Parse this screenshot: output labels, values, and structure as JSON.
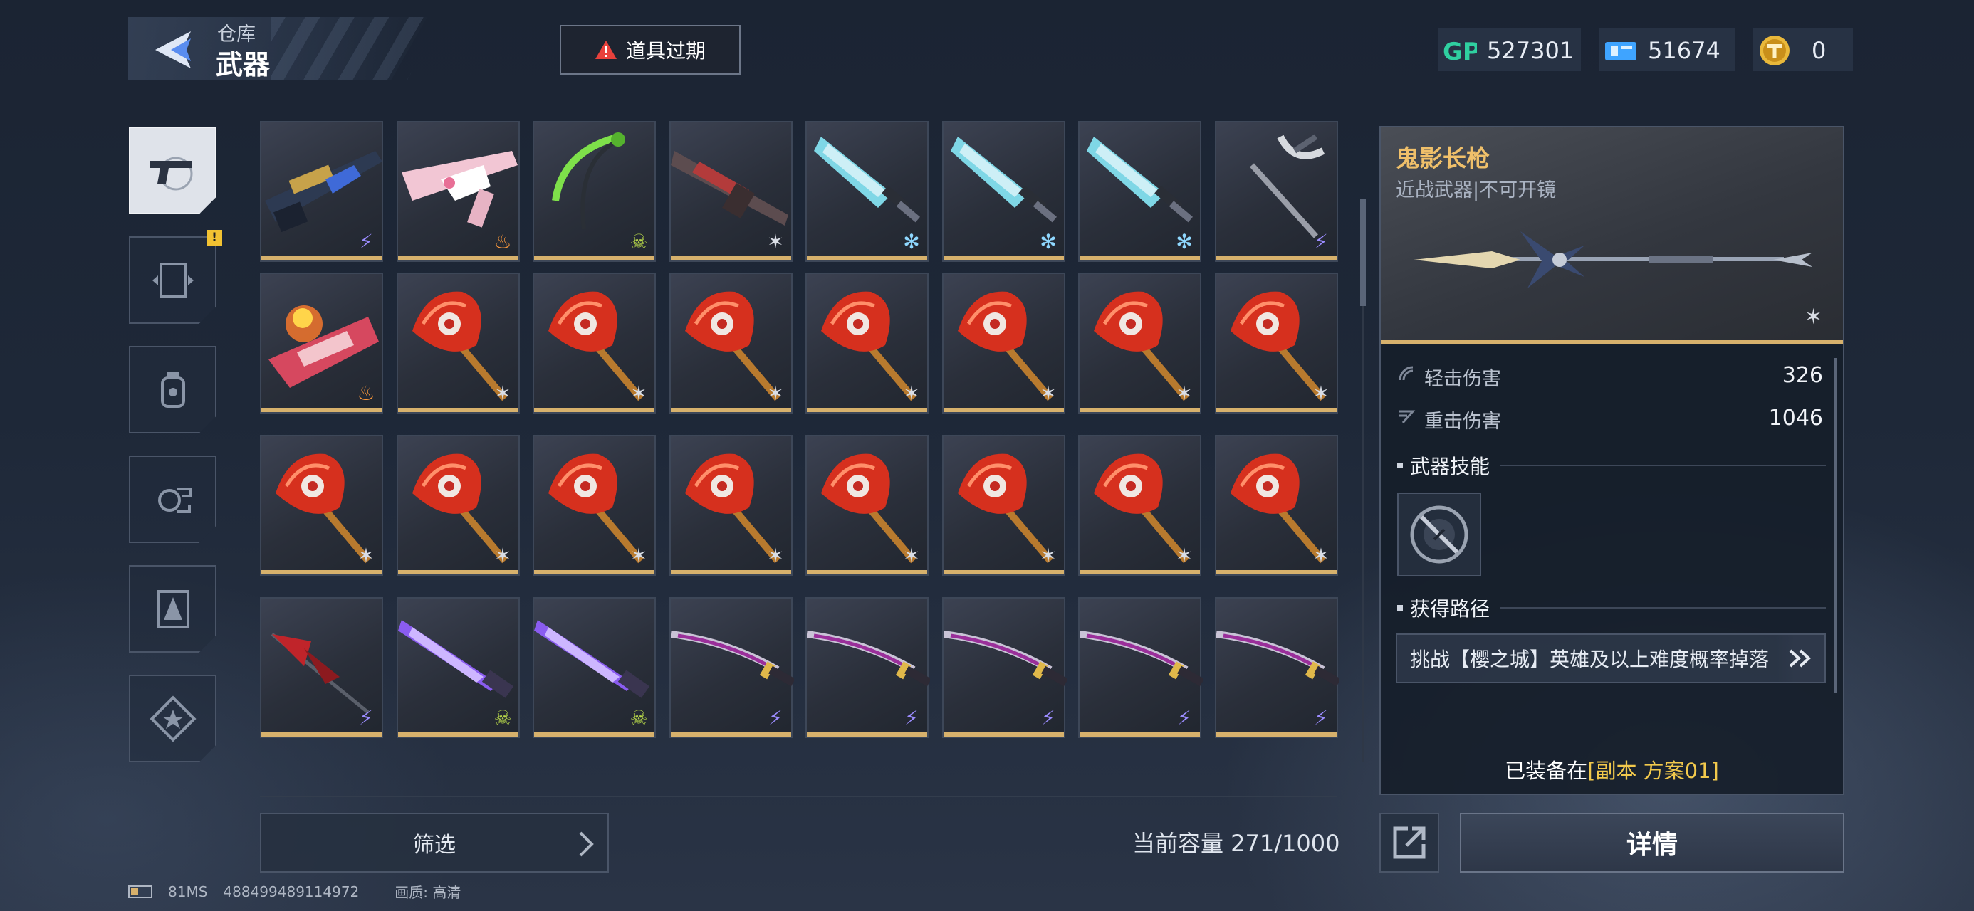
{
  "header": {
    "breadcrumb_parent": "仓库",
    "title": "武器",
    "warning_button": "道具过期"
  },
  "currencies": [
    {
      "name": "gp-icon",
      "label": "GP",
      "value": "527301"
    },
    {
      "name": "ticket-icon",
      "value": "51674"
    },
    {
      "name": "coin-icon",
      "value": "0"
    }
  ],
  "sidebar": {
    "tabs": [
      {
        "name": "tab-weapons",
        "icon": "pistol-icon",
        "active": true
      },
      {
        "name": "tab-frames",
        "icon": "frame-icon",
        "badge": "!"
      },
      {
        "name": "tab-grenades",
        "icon": "grenade-icon"
      },
      {
        "name": "tab-parts",
        "icon": "parts-icon"
      },
      {
        "name": "tab-cards",
        "icon": "card-icon"
      },
      {
        "name": "tab-favorites",
        "icon": "star-icon"
      }
    ]
  },
  "inventory": {
    "rows": [
      [
        "rifle-blue",
        "rifle-pink",
        "scythe-green",
        "rifle-dark",
        "blade-ice",
        "blade-ice",
        "blade-ice",
        "pickaxe"
      ],
      [
        "launcher-fire",
        "staff-red",
        "staff-red",
        "staff-red",
        "staff-red",
        "staff-red",
        "staff-red",
        "staff-red"
      ],
      [
        "staff-red",
        "staff-red",
        "staff-red",
        "staff-red",
        "staff-red",
        "staff-red",
        "staff-red",
        "staff-red"
      ],
      [
        "spear-red",
        "sword-purple",
        "sword-purple",
        "katana-purple",
        "katana-purple",
        "katana-purple",
        "katana-purple",
        "katana-purple"
      ]
    ],
    "rarity": [
      [
        "lightning",
        "fire",
        "skull",
        "star",
        "snow",
        "snow",
        "snow",
        "lightning"
      ],
      [
        "fire",
        "star",
        "star",
        "star",
        "star",
        "star",
        "star",
        "star"
      ],
      [
        "star",
        "star",
        "star",
        "star",
        "star",
        "star",
        "star",
        "star"
      ],
      [
        "lightning",
        "skull",
        "skull",
        "lightning",
        "lightning",
        "lightning",
        "lightning",
        "lightning"
      ]
    ],
    "capacity_label": "当前容量 271/1000"
  },
  "colors": {
    "gold": "#d7b16c",
    "weapon_name": "#f0c06a",
    "equipped_highlight": "#f2c94c",
    "lightning": "#9b8cff",
    "fire": "#ff9a3c",
    "skull": "#b7d84a",
    "snow": "#8fd8ff",
    "star": "#d9dde5"
  },
  "detail": {
    "name": "鬼影长枪",
    "subtitle": "近战武器|不可开镜",
    "stats": [
      {
        "label": "轻击伤害",
        "value": "326"
      },
      {
        "label": "重击伤害",
        "value": "1046"
      }
    ],
    "skill_title": "武器技能",
    "route_title": "获得路径",
    "route_text": "挑战【樱之城】英雄及以上难度概率掉落",
    "equipped_prefix": "已装备在",
    "equipped_plan": "[副本 方案01]"
  },
  "bottom": {
    "filter_label": "筛选",
    "details_label": "详情"
  },
  "status_bar": {
    "ping": "81MS",
    "uid": "488499489114972",
    "quality": "画质:  高清"
  }
}
